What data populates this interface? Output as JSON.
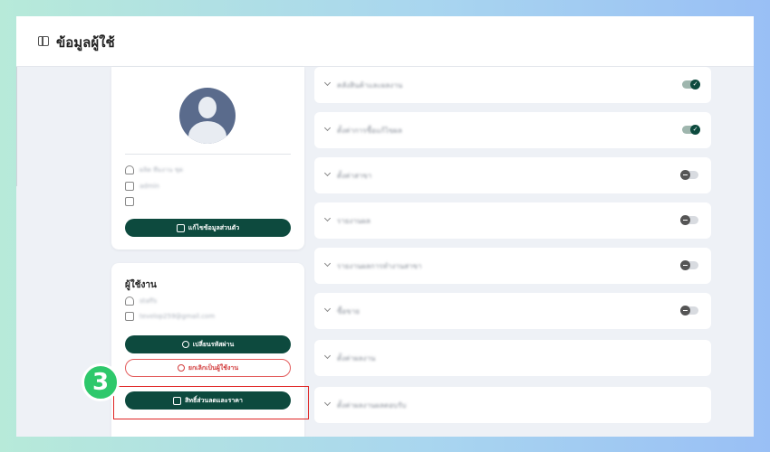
{
  "header": {
    "title": "ข้อมูลผู้ใช้",
    "icon": "sidebar-panel-icon"
  },
  "profile": {
    "name": "ผลิต ทีมงาน ชุด",
    "role": "admin",
    "extra": "",
    "edit_button": "แก้ไขข้อมูลส่วนตัว"
  },
  "staff": {
    "title": "ผู้ใช้งาน",
    "username": "staffs",
    "email": "tevelop259@gmail.com",
    "change_password_button": "เปลี่ยนรหัสผ่าน",
    "cancel_user_button": "ยกเลิกเป็นผู้ใช้งาน",
    "discount_button": "สิทธิ์ส่วนลดและราคา"
  },
  "step_badge": "3",
  "permissions": [
    {
      "label": "คลังสินค้าและผลงาน",
      "toggle": "on"
    },
    {
      "label": "ตั้งค่าการซื้อแก้ไขผล",
      "toggle": "on"
    },
    {
      "label": "ตั้งค่าสาขา",
      "toggle": "off"
    },
    {
      "label": "รายงานผล",
      "toggle": "off"
    },
    {
      "label": "รายงานผลการทำงานสาขา",
      "toggle": "off"
    },
    {
      "label": "ซื้อขาย",
      "toggle": "off"
    },
    {
      "label": "ตั้งค่าผลงาน",
      "toggle": "none"
    },
    {
      "label": "ตั้งค่าผลงานผลตอบรับ",
      "toggle": "none"
    }
  ],
  "colors": {
    "primary": "#0d4a3e",
    "danger": "#d23b3b",
    "badge": "#2ec86b",
    "highlight": "#e02424"
  }
}
